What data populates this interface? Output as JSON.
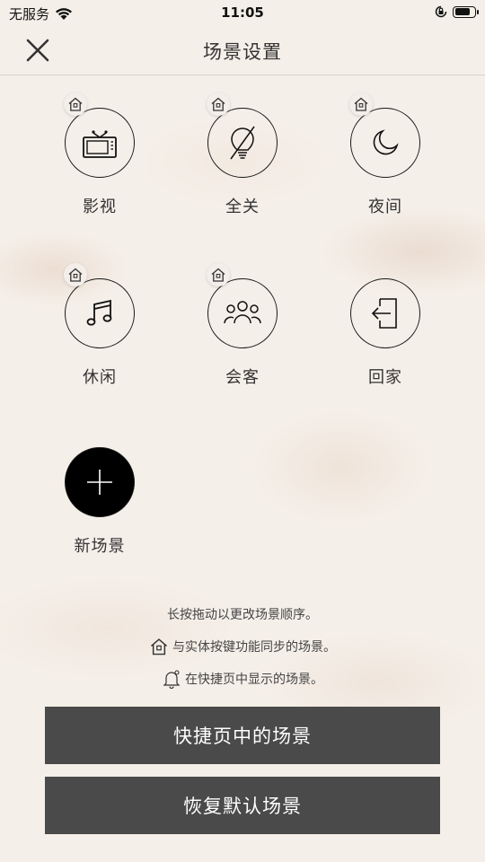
{
  "status": {
    "carrier": "无服务",
    "time": "11:05",
    "battery_level": 0.8
  },
  "nav": {
    "title": "场景设置"
  },
  "scenes": [
    {
      "label": "影视",
      "icon": "tv-icon",
      "synced": true
    },
    {
      "label": "全关",
      "icon": "bulb-off-icon",
      "synced": true
    },
    {
      "label": "夜间",
      "icon": "moon-icon",
      "synced": true
    },
    {
      "label": "休闲",
      "icon": "music-icon",
      "synced": true
    },
    {
      "label": "会客",
      "icon": "guests-icon",
      "synced": true
    },
    {
      "label": "回家",
      "icon": "home-enter-icon",
      "synced": false
    },
    {
      "label": "新场景",
      "icon": "plus-icon",
      "synced": false
    }
  ],
  "hints": {
    "reorder": "长按拖动以更改场景顺序。",
    "synced": "与实体按键功能同步的场景。",
    "quick": "在快捷页中显示的场景。"
  },
  "buttons": {
    "quick_scenes": "快捷页中的场景",
    "restore_default": "恢复默认场景"
  }
}
